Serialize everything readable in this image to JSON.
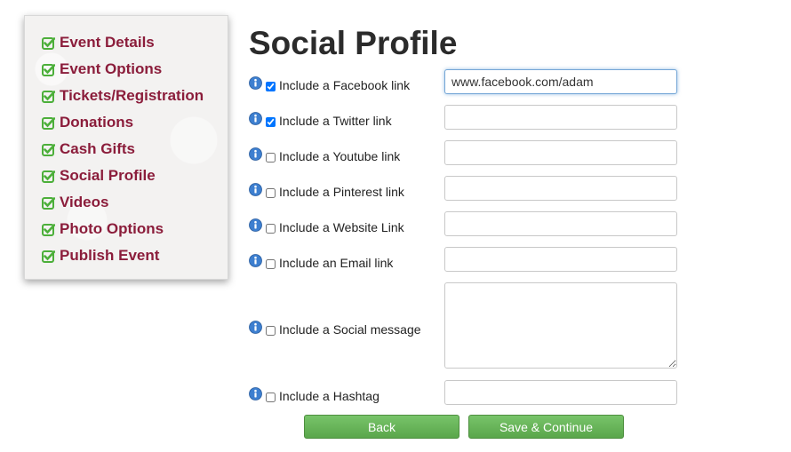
{
  "sidebar": {
    "items": [
      {
        "label": "Event Details"
      },
      {
        "label": "Event Options"
      },
      {
        "label": "Tickets/Registration"
      },
      {
        "label": "Donations"
      },
      {
        "label": "Cash Gifts"
      },
      {
        "label": "Social Profile"
      },
      {
        "label": "Videos"
      },
      {
        "label": "Photo Options"
      },
      {
        "label": "Publish Event"
      }
    ],
    "check_icon": "check-square-icon",
    "label_color": "#8b1d3b",
    "check_color": "#4caf3a"
  },
  "page": {
    "title": "Social Profile"
  },
  "form": {
    "info_icon": "info-icon",
    "rows": [
      {
        "label": "Include a Facebook link",
        "checked": true,
        "value": "www.facebook.com/adam",
        "placeholder": ""
      },
      {
        "label": "Include a Twitter link",
        "checked": true,
        "value": "",
        "placeholder": ""
      },
      {
        "label": "Include a Youtube link",
        "checked": false,
        "value": "",
        "placeholder": ""
      },
      {
        "label": "Include a Pinterest link",
        "checked": false,
        "value": "",
        "placeholder": ""
      },
      {
        "label": "Include a Website Link",
        "checked": false,
        "value": "",
        "placeholder": ""
      },
      {
        "label": "Include an Email link",
        "checked": false,
        "value": "",
        "placeholder": ""
      },
      {
        "label": "Include a Social message",
        "checked": false,
        "value": "",
        "placeholder": ""
      },
      {
        "label": "Include a Hashtag",
        "checked": false,
        "value": "",
        "placeholder": ""
      }
    ]
  },
  "buttons": {
    "back_label": "Back",
    "save_label": "Save & Continue",
    "color": "#5fae50"
  }
}
